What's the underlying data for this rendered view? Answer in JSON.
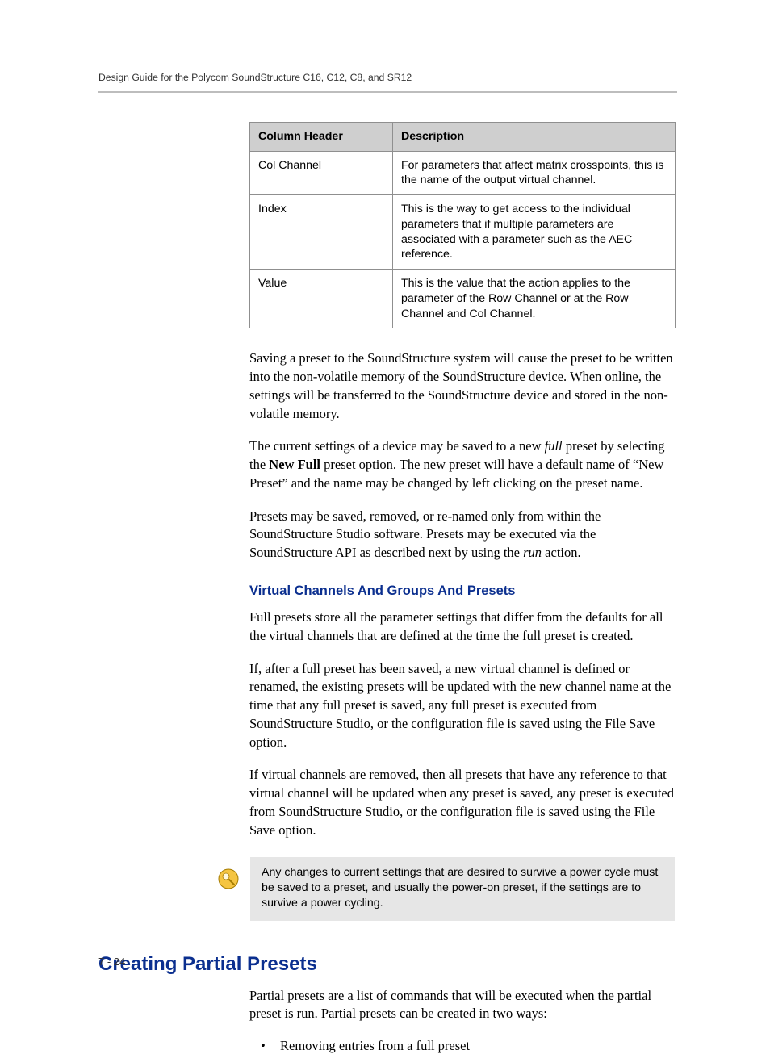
{
  "header": {
    "running_title": "Design Guide for the Polycom SoundStructure C16, C12, C8, and SR12"
  },
  "table": {
    "head": {
      "c1": "Column Header",
      "c2": "Description"
    },
    "rows": [
      {
        "c1": "Col Channel",
        "c2": "For parameters that affect matrix crosspoints, this is the name of the output virtual channel."
      },
      {
        "c1": "Index",
        "c2": "This is the way to get access to the individual parameters that if multiple parameters are associated with a parameter such as the AEC reference."
      },
      {
        "c1": "Value",
        "c2": "This is the value that the action applies to the parameter of the Row Channel or at the Row Channel and Col Channel."
      }
    ]
  },
  "body": {
    "p1": "Saving a preset to the SoundStructure system will cause the preset to be written into the non-volatile memory of the SoundStructure device. When online, the settings will be transferred to the SoundStructure device and stored in the non-volatile memory.",
    "p2a": "The current settings of a device may be saved to a new ",
    "p2_em": "full",
    "p2b": " preset by selecting the ",
    "p2_strong": "New Full",
    "p2c": " preset option. The new preset will have a default name of “New Preset” and the name may be changed by left clicking on the preset name.",
    "p3a": "Presets may be saved, removed, or re-named only from within the SoundStructure Studio software. Presets may be executed via the SoundStructure API as described next by using the ",
    "p3_em": "run",
    "p3b": " action.",
    "sub1": "Virtual Channels And Groups And Presets",
    "p4": "Full presets store all the parameter settings that differ from the defaults for all the virtual channels that are defined at the time the full preset is created.",
    "p5": "If, after a full preset has been saved, a new virtual channel is defined or renamed, the existing presets will be updated with the new channel name at the time that any full preset is saved, any full preset is executed from SoundStructure Studio, or the configuration file is saved using the File Save option.",
    "p6": "If virtual channels are removed, then all presets that have any reference to that virtual channel will be updated when any preset is saved, any preset is executed from SoundStructure Studio, or the configuration file is saved using the File Save option."
  },
  "note": {
    "text": "Any changes to current settings that are desired to survive a power cycle must be saved to a preset, and usually the power-on preset, if the settings are to survive a power cycling."
  },
  "section2": {
    "title": "Creating Partial Presets",
    "p1": "Partial presets are a list of commands that will be executed when the partial preset is run. Partial presets can be created in two ways:",
    "bullet1": "Removing entries from a full preset"
  },
  "footer": {
    "page": "7 - 24"
  }
}
